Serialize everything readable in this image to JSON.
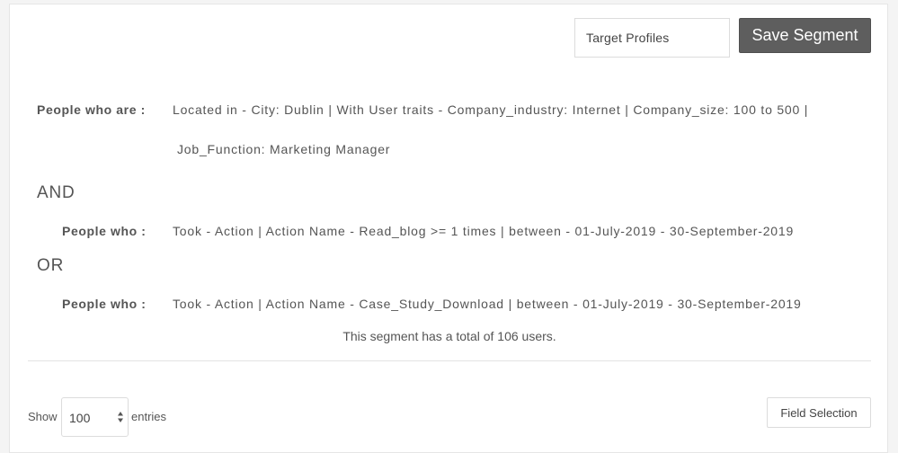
{
  "header": {
    "segment_name_value": "Target Profiles",
    "save_button_label": "Save Segment"
  },
  "rules": {
    "people_who_are_label": "People who are :",
    "location_criteria_line1": "Located in - City: Dublin | With User traits - Company_industry: Internet |  Company_size: 100 to 500 |",
    "location_criteria_line2": "Job_Function: Marketing Manager",
    "and_label": "AND",
    "people_who_label_1": "People who :",
    "action_criteria_1": "Took - Action | Action Name - Read_blog >= 1 times | between - 01-July-2019 - 30-September-2019",
    "or_label": "OR",
    "people_who_label_2": "People who :",
    "action_criteria_2": "Took - Action | Action Name - Case_Study_Download  | between - 01-July-2019 - 30-September-2019"
  },
  "summary": {
    "total_text": "This segment has a total of 106 users."
  },
  "table_controls": {
    "show_label": "Show",
    "entries_value": "100",
    "entries_label": "entries",
    "field_selection_label": "Field Selection"
  },
  "colors": {
    "save_button_bg": "#5e5e5e",
    "text": "#555555",
    "border": "#dcdcdc"
  },
  "icons": {
    "select_arrows": "updown-arrows-icon"
  }
}
